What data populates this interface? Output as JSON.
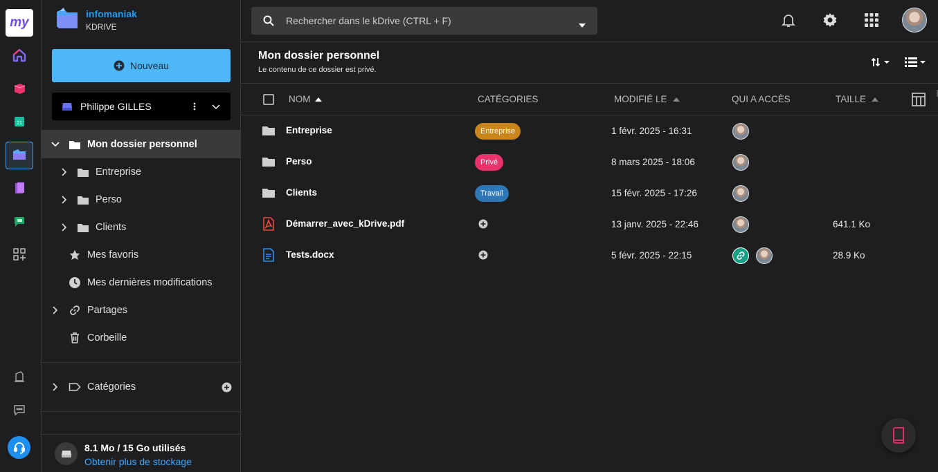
{
  "rail": {
    "logo": "my",
    "items": [
      "home-icon",
      "mail-icon",
      "calendar-icon",
      "kdrive-icon",
      "kmeet-icon",
      "kchat-icon",
      "apps-grid-icon"
    ],
    "bottom": [
      "sign-icon",
      "chat-bubble-icon",
      "support-icon"
    ],
    "colors": {
      "accent": "#4aa3f0",
      "support": "#1d8ff0"
    }
  },
  "brand": {
    "name": "infomaniak",
    "product": "KDRIVE"
  },
  "sidebar": {
    "new_label": "Nouveau",
    "user": "Philippe GILLES",
    "tree": [
      {
        "label": "Mon dossier personnel",
        "icon": "folder-icon"
      },
      {
        "label": "Entreprise",
        "icon": "folder-icon"
      },
      {
        "label": "Perso",
        "icon": "folder-icon"
      },
      {
        "label": "Clients",
        "icon": "folder-icon"
      },
      {
        "label": "Mes favoris",
        "icon": "star-icon"
      },
      {
        "label": "Mes dernières modifications",
        "icon": "clock-icon"
      },
      {
        "label": "Partages",
        "icon": "link-icon"
      },
      {
        "label": "Corbeille",
        "icon": "trash-icon"
      }
    ],
    "categories": "Catégories",
    "storage_used": "8.1 Mo / 15 Go utilisés",
    "storage_link": "Obtenir plus de stockage"
  },
  "search": {
    "placeholder": "Rechercher dans le kDrive (CTRL + F)"
  },
  "header": {
    "title": "Mon dossier personnel",
    "subtitle": "Le contenu de ce dossier est privé."
  },
  "columns": {
    "name": "NOM",
    "categories": "CATÉGORIES",
    "modified": "MODIFIÉ LE",
    "access": "QUI A ACCÈS",
    "size": "TAILLE"
  },
  "rows": [
    {
      "name": "Entreprise",
      "type": "folder",
      "tag": "Entreprise",
      "tag_color": "#c8861b",
      "date": "1 févr. 2025 - 16:31",
      "size": ""
    },
    {
      "name": "Perso",
      "type": "folder",
      "tag": "Privé",
      "tag_color": "#e8336b",
      "date": "8 mars 2025 - 18:06",
      "size": ""
    },
    {
      "name": "Clients",
      "type": "folder",
      "tag": "Travail",
      "tag_color": "#2f78b8",
      "date": "15 févr. 2025 - 17:26",
      "size": ""
    },
    {
      "name": "Démarrer_avec_kDrive.pdf",
      "type": "pdf",
      "tag": "",
      "tag_color": "",
      "date": "13 janv. 2025 - 22:46",
      "size": "641.1 Ko"
    },
    {
      "name": "Tests.docx",
      "type": "docx",
      "tag": "",
      "tag_color": "",
      "date": "5 févr. 2025 - 22:15",
      "size": "28.9 Ko",
      "shared_link": true
    }
  ]
}
